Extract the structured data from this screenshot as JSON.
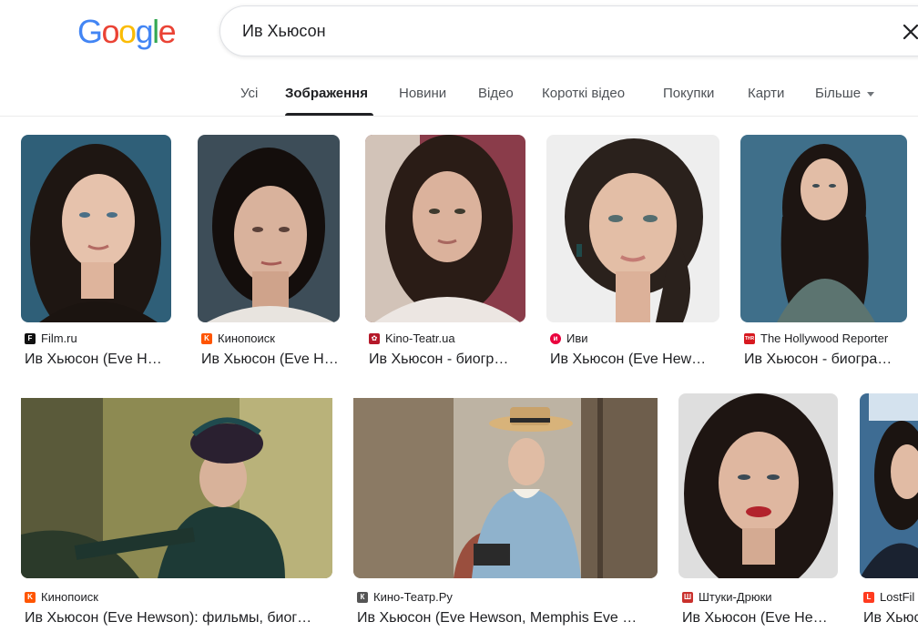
{
  "logo": {
    "letters": [
      "G",
      "o",
      "o",
      "g",
      "l",
      "e"
    ],
    "colors": [
      "#4285F4",
      "#EA4335",
      "#FBBC05",
      "#4285F4",
      "#34A853",
      "#EA4335"
    ]
  },
  "search": {
    "query": "Ив Хьюсон",
    "clear_icon": "close-icon"
  },
  "tabs": [
    {
      "label": "Усі",
      "active": false
    },
    {
      "label": "Зображення",
      "active": true
    },
    {
      "label": "Новини",
      "active": false
    },
    {
      "label": "Відео",
      "active": false
    },
    {
      "label": "Короткі відео",
      "active": false
    },
    {
      "label": "Покупки",
      "active": false
    },
    {
      "label": "Карти",
      "active": false
    },
    {
      "label": "Більше",
      "active": false
    }
  ],
  "results": [
    {
      "source": "Film.ru",
      "title": "Ив Хьюсон (Eve H…",
      "favicon_color": "#111111",
      "favicon_glyph": "F"
    },
    {
      "source": "Кинопоиск",
      "title": "Ив Хьюсон (Eve H…",
      "favicon_color": "#ff5500",
      "favicon_glyph": "K"
    },
    {
      "source": "Kino-Teatr.ua",
      "title": "Ив Хьюсон - биогр…",
      "favicon_color": "#b5192a",
      "favicon_glyph": "✿"
    },
    {
      "source": "Иви",
      "title": "Ив Хьюсон (Eve Hew…",
      "favicon_color": "#ea003d",
      "favicon_glyph": "и"
    },
    {
      "source": "The Hollywood Reporter",
      "title": "Ив Хьюсон - биогра…",
      "favicon_color": "#d71920",
      "favicon_glyph": "THR"
    },
    {
      "source": "Кинопоиск",
      "title": "Ив Хьюсон (Eve Hewson): фильмы, биог…",
      "favicon_color": "#ff5500",
      "favicon_glyph": "K"
    },
    {
      "source": "Кино-Театр.Ру",
      "title": "Ив Хьюсон (Eve Hewson, Memphis Eve …",
      "favicon_color": "#555555",
      "favicon_glyph": "К"
    },
    {
      "source": "Штуки-Дрюки",
      "title": "Ив Хьюсон (Eve He…",
      "favicon_color": "#c9302c",
      "favicon_glyph": "Ш"
    },
    {
      "source": "LostFil",
      "title": "Ив Хьюс",
      "favicon_color": "#ff3b1f",
      "favicon_glyph": "L"
    }
  ]
}
